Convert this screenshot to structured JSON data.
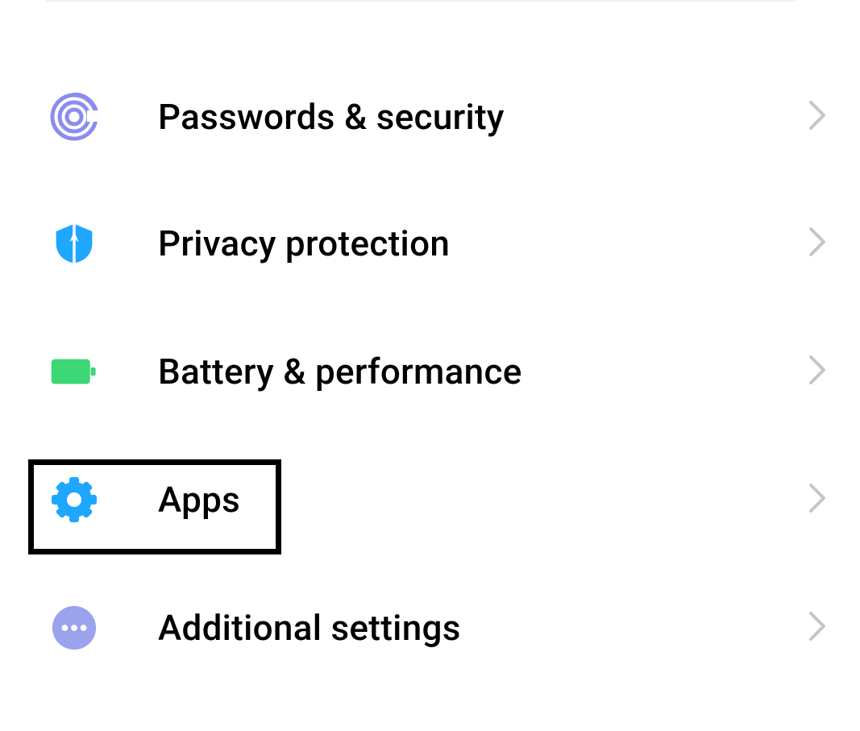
{
  "items": [
    {
      "label": "Passwords & security",
      "icon": "fingerprint",
      "color": "#8a8cf0"
    },
    {
      "label": "Privacy protection",
      "icon": "shield",
      "color": "#1fa6ff"
    },
    {
      "label": "Battery & performance",
      "icon": "battery",
      "color": "#3cd777"
    },
    {
      "label": "Apps",
      "icon": "gear",
      "color": "#1fa6ff"
    },
    {
      "label": "Additional settings",
      "icon": "dots",
      "color": "#9aa3ec"
    }
  ]
}
